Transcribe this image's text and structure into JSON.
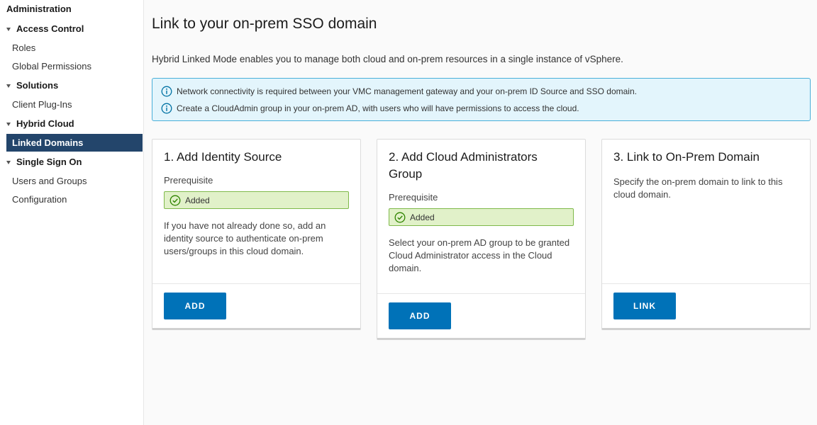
{
  "sidebar": {
    "title": "Administration",
    "groups": [
      {
        "label": "Access Control",
        "items": [
          "Roles",
          "Global Permissions"
        ]
      },
      {
        "label": "Solutions",
        "items": [
          "Client Plug-Ins"
        ]
      },
      {
        "label": "Hybrid Cloud",
        "items": [
          "Linked Domains"
        ]
      },
      {
        "label": "Single Sign On",
        "items": [
          "Users and Groups",
          "Configuration"
        ]
      }
    ],
    "active_item": "Linked Domains"
  },
  "main": {
    "title": "Link to your on-prem SSO domain",
    "description": "Hybrid Linked Mode enables you to manage both cloud and on-prem resources in a single instance of vSphere.",
    "alerts": [
      "Network connectivity is required between your VMC management gateway and your on-prem ID Source and SSO domain.",
      "Create a CloudAdmin group in your on-prem AD, with users who will have permissions to access the cloud."
    ],
    "cards": [
      {
        "title": "1. Add Identity Source",
        "prereq_label": "Prerequisite",
        "status": "Added",
        "text": "If you have not already done so, add an identity source to authenticate on-prem users/groups in this cloud domain.",
        "button": "ADD"
      },
      {
        "title": "2. Add Cloud Administrators Group",
        "prereq_label": "Prerequisite",
        "status": "Added",
        "text": "Select your on-prem AD group to be granted Cloud Administrator access in the Cloud domain.",
        "button": "ADD"
      },
      {
        "title": "3. Link to On-Prem Domain",
        "text": "Specify the on-prem domain to link to this cloud domain.",
        "button": "LINK"
      }
    ]
  },
  "colors": {
    "accent": "#0072b8",
    "sidebar_active": "#23456b",
    "info_bg": "#e3f5fc",
    "info_border": "#49afd9",
    "success_bg": "#e1f1c9",
    "success_border": "#7fb94a"
  }
}
